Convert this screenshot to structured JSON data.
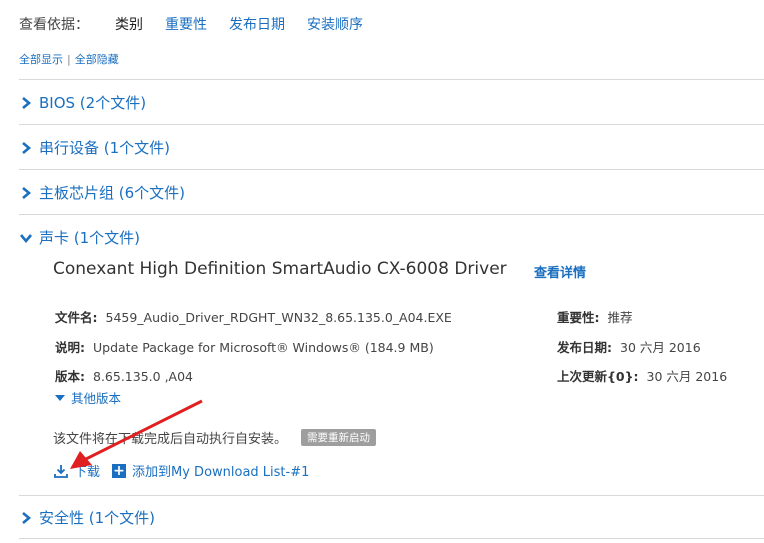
{
  "sort": {
    "label": "查看依据：",
    "options": [
      {
        "label": "类别",
        "active": true
      },
      {
        "label": "重要性",
        "active": false
      },
      {
        "label": "发布日期",
        "active": false
      },
      {
        "label": "安装顺序",
        "active": false
      }
    ]
  },
  "toggle": {
    "show_all": "全部显示",
    "separator": "|",
    "hide_all": "全部隐藏"
  },
  "categories": [
    {
      "label": "BIOS (2个文件)",
      "expanded": false
    },
    {
      "label": "串行设备 (1个文件)",
      "expanded": false
    },
    {
      "label": "主板芯片组 (6个文件)",
      "expanded": false
    },
    {
      "label": "声卡 (1个文件)",
      "expanded": true
    },
    {
      "label": "安全性 (1个文件)",
      "expanded": false
    }
  ],
  "driver": {
    "title": "Conexant High Definition SmartAudio CX-6008 Driver",
    "details_link": "查看详情",
    "filename_label": "文件名:",
    "filename": "5459_Audio_Driver_RDGHT_WN32_8.65.135.0_A04.EXE",
    "desc_label": "说明:",
    "desc": "Update Package for Microsoft® Windows® (184.9 MB)",
    "version_label": "版本:",
    "version": "8.65.135.0 ,A04",
    "importance_label": "重要性:",
    "importance": "推荐",
    "release_label": "发布日期:",
    "release": "30 六月 2016",
    "updated_label": "上次更新{0}:",
    "updated": "30 六月 2016",
    "other_versions": "其他版本",
    "note": "该文件将在下载完成后自动执行自安装。",
    "badge": "需要重新启动",
    "download": "下载",
    "add_to_list": "添加到My Download List-#1"
  },
  "colors": {
    "link": "#1a6fc0",
    "annotation_arrow": "#e02020",
    "badge": "#9e9e9e"
  }
}
